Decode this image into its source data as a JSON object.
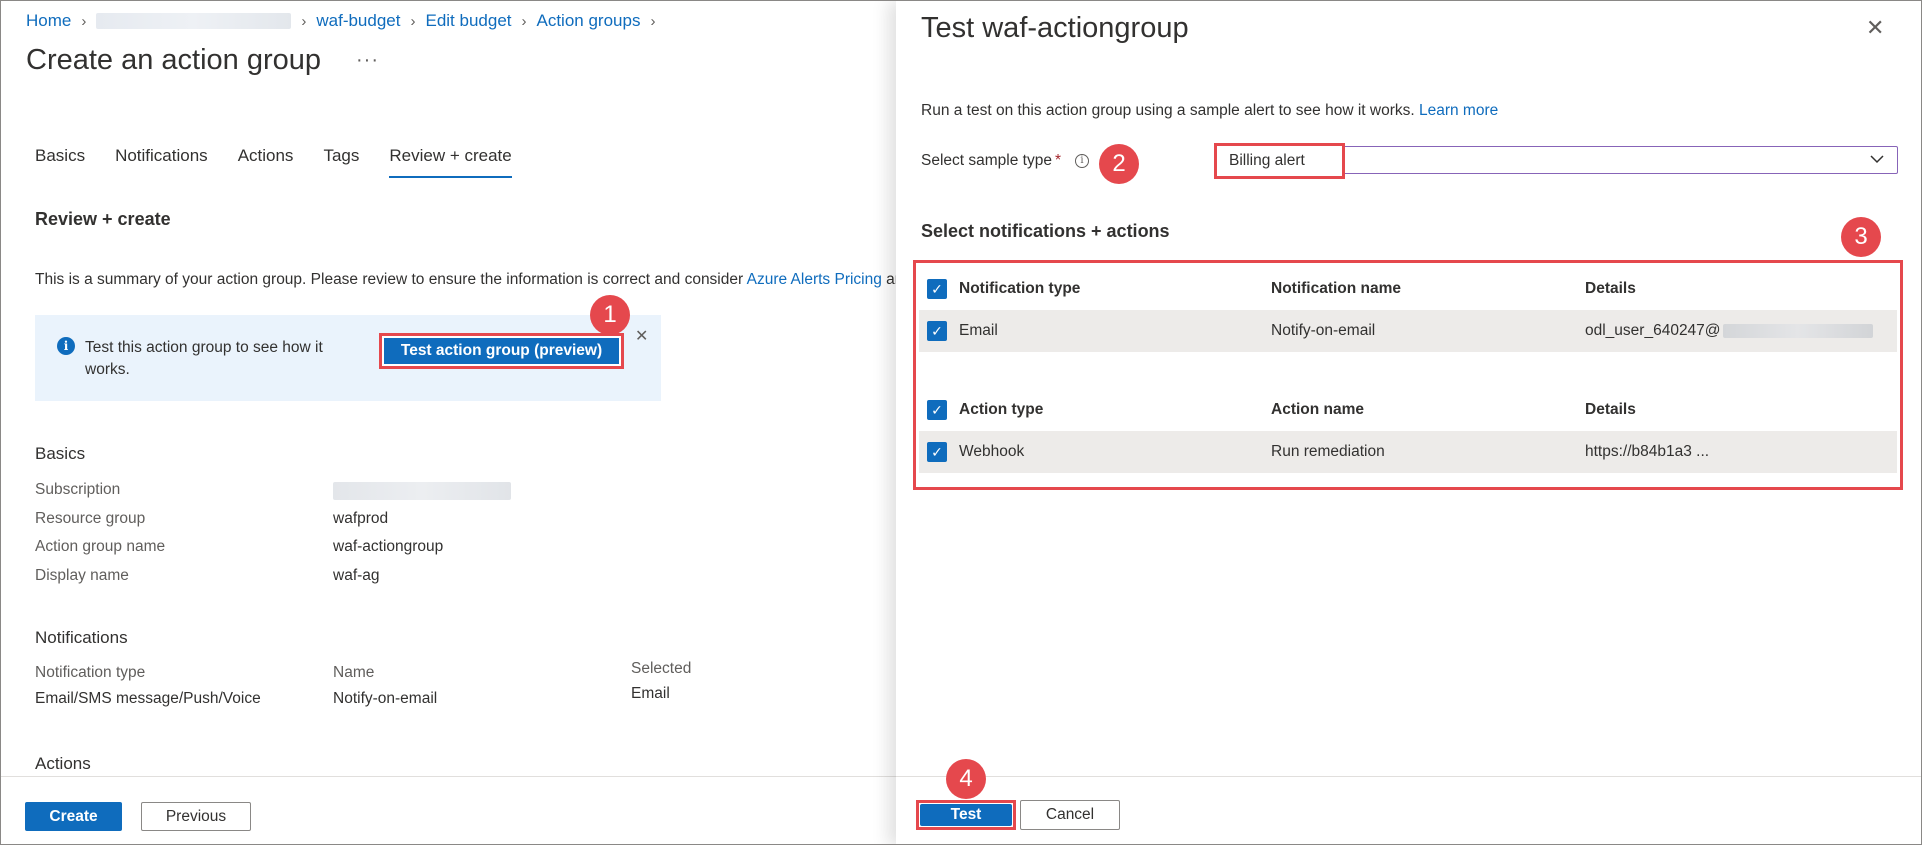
{
  "breadcrumb": {
    "home": "Home",
    "items": [
      "waf-budget",
      "Edit budget",
      "Action groups"
    ]
  },
  "page": {
    "title": "Create an action group",
    "more": "···"
  },
  "tabs": [
    "Basics",
    "Notifications",
    "Actions",
    "Tags",
    "Review + create"
  ],
  "active_tab": "Review + create",
  "review": {
    "heading": "Review + create",
    "summary_text": "This is a summary of your action group. Please review to ensure the information is correct and consider ",
    "summary_link": "Azure Alerts Pricing",
    "summary_tail": " and"
  },
  "banner": {
    "text": "Test this action group to see how it works.",
    "button": "Test action group (preview)",
    "close": "✕"
  },
  "basics": {
    "heading": "Basics",
    "rows": [
      {
        "label": "Subscription",
        "value": ""
      },
      {
        "label": "Resource group",
        "value": "wafprod"
      },
      {
        "label": "Action group name",
        "value": "waf-actiongroup"
      },
      {
        "label": "Display name",
        "value": "waf-ag"
      }
    ]
  },
  "notifications": {
    "heading": "Notifications",
    "col1_label": "Notification type",
    "col1_value": "Email/SMS message/Push/Voice",
    "col2_label": "Name",
    "col2_value": "Notify-on-email",
    "col3_label": "Selected",
    "col3_value": "Email"
  },
  "actions": {
    "heading": "Actions"
  },
  "left_footer": {
    "create": "Create",
    "previous": "Previous"
  },
  "panel": {
    "title": "Test waf-actiongroup",
    "close": "✕",
    "description": "Run a test on this action group using a sample alert to see how it works. ",
    "learn_more": "Learn more",
    "sample_label": "Select sample type",
    "required": "*",
    "help": "i",
    "sample_value": "Billing alert",
    "section_heading": "Select notifications + actions",
    "notif_headers": [
      "Notification type",
      "Notification name",
      "Details"
    ],
    "notif_row": {
      "type": "Email",
      "name": "Notify-on-email",
      "details": "odl_user_640247@"
    },
    "action_headers": [
      "Action type",
      "Action name",
      "Details"
    ],
    "action_row": {
      "type": "Webhook",
      "name": "Run remediation",
      "details": "https://b84b1a3 ..."
    },
    "test": "Test",
    "cancel": "Cancel"
  },
  "badges": [
    "1",
    "2",
    "3",
    "4"
  ],
  "colors": {
    "accent": "#0f6cbd",
    "highlight_red": "#e5484d",
    "select_border": "#8764b8",
    "banner_bg": "#eaf3fc"
  }
}
